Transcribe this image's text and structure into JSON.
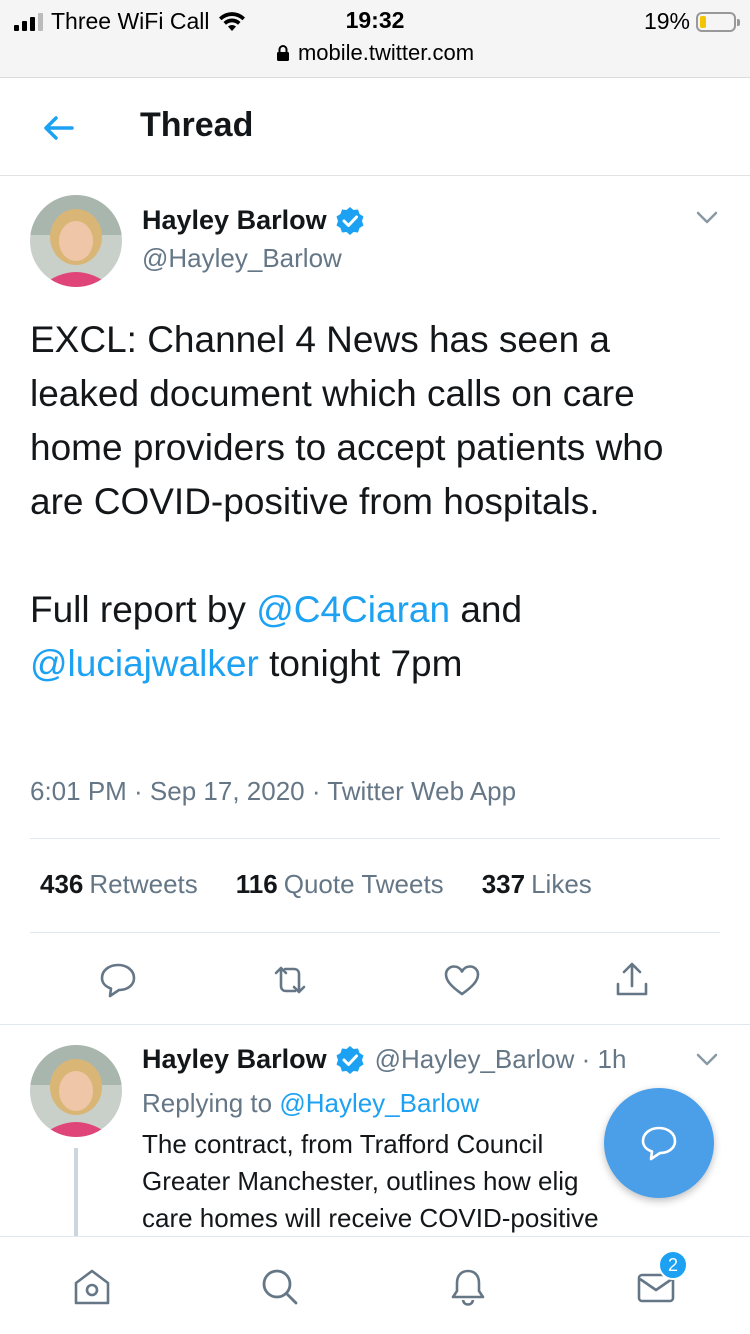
{
  "status_bar": {
    "carrier": "Three WiFi Call",
    "time": "19:32",
    "battery": "19%",
    "battery_level": 0.19,
    "url": "mobile.twitter.com"
  },
  "header": {
    "title": "Thread"
  },
  "main_tweet": {
    "name": "Hayley Barlow",
    "handle": "@Hayley_Barlow",
    "text_line1": "EXCL: Channel 4 News has seen a leaked document which calls on care home providers to accept patients who are COVID-positive from hospitals.",
    "text_full_prefix": "Full report by ",
    "mention1": "@C4Ciaran",
    "text_and": " and",
    "mention2": "@luciajwalker",
    "text_suffix": " tonight 7pm",
    "meta": "6:01 PM · Sep 17, 2020 · Twitter Web App",
    "retweets_count": "436",
    "retweets_label": "Retweets",
    "quotes_count": "116",
    "quotes_label": "Quote Tweets",
    "likes_count": "337",
    "likes_label": "Likes"
  },
  "reply_tweet": {
    "name": "Hayley Barlow",
    "handle_time": "@Hayley_Barlow · 1h",
    "replying_prefix": "Replying to ",
    "replying_to": "@Hayley_Barlow",
    "line1": "The contract, from Trafford Council",
    "line2": "Greater Manchester, outlines how elig",
    "line3": "care homes will receive COVID-positive"
  },
  "bottom_nav": {
    "messages_badge": "2"
  },
  "colors": {
    "accent": "#1da1f2",
    "secondary_text": "#657786",
    "fab": "#4a9fe8"
  }
}
